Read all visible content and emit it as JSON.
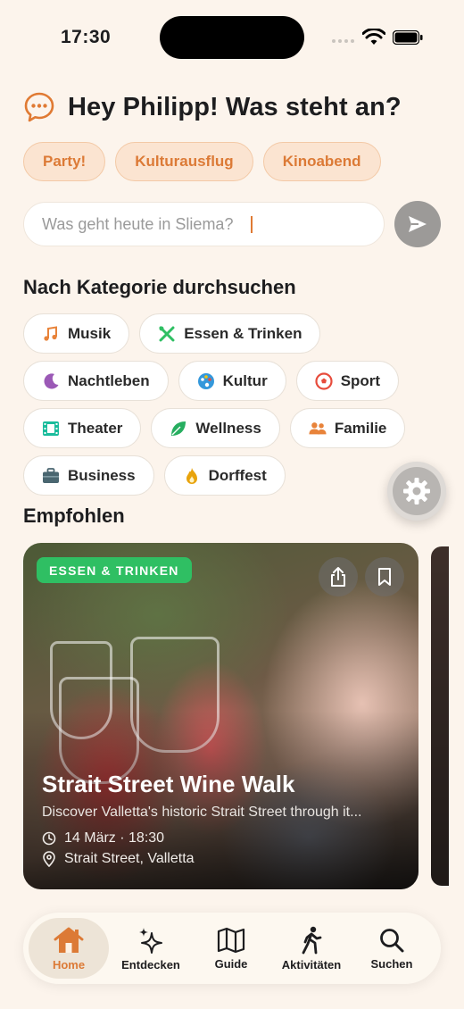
{
  "status_bar": {
    "time": "17:30"
  },
  "header": {
    "title": "Hey Philipp! Was steht an?",
    "icon": "chat-bubble-icon",
    "accent": "#E07A33"
  },
  "quick_chips": [
    {
      "label": "Party!"
    },
    {
      "label": "Kulturausflug"
    },
    {
      "label": "Kinoabend"
    }
  ],
  "search": {
    "placeholder": "Was geht heute in Sliema?",
    "value": ""
  },
  "categories": {
    "title": "Nach Kategorie durchsuchen",
    "items": [
      {
        "label": "Musik",
        "icon": "music-note-icon",
        "color": "#E8833A"
      },
      {
        "label": "Essen & Trinken",
        "icon": "utensils-icon",
        "color": "#2FBF63"
      },
      {
        "label": "Nachtleben",
        "icon": "moon-icon",
        "color": "#9B59B6"
      },
      {
        "label": "Kultur",
        "icon": "palette-icon",
        "color": "#3498DB"
      },
      {
        "label": "Sport",
        "icon": "soccer-ball-icon",
        "color": "#E74C3C"
      },
      {
        "label": "Theater",
        "icon": "film-icon",
        "color": "#1ABC9C"
      },
      {
        "label": "Wellness",
        "icon": "leaf-icon",
        "color": "#27AE60"
      },
      {
        "label": "Familie",
        "icon": "family-icon",
        "color": "#E8833A"
      },
      {
        "label": "Business",
        "icon": "briefcase-icon",
        "color": "#4A6670"
      },
      {
        "label": "Dorffest",
        "icon": "flame-icon",
        "color": "#E8A30C"
      }
    ]
  },
  "recommended": {
    "title": "Empfohlen",
    "card": {
      "badge": "ESSEN & TRINKEN",
      "title": "Strait Street Wine Walk",
      "description": "Discover Valletta's historic Strait Street through it...",
      "datetime": "14 März · 18:30",
      "location": "Strait Street, Valletta"
    }
  },
  "tab_bar": {
    "items": [
      {
        "label": "Home",
        "icon": "home-icon",
        "active": true
      },
      {
        "label": "Entdecken",
        "icon": "sparkles-icon"
      },
      {
        "label": "Guide",
        "icon": "map-icon"
      },
      {
        "label": "Aktivitäten",
        "icon": "walking-icon"
      },
      {
        "label": "Suchen",
        "icon": "magnifier-icon"
      }
    ]
  }
}
